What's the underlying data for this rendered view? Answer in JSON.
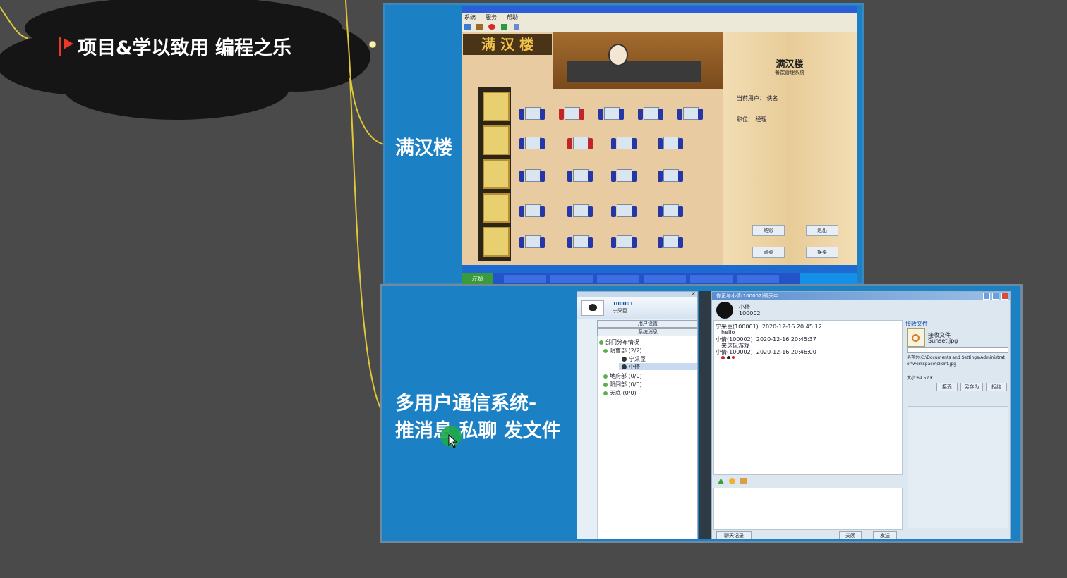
{
  "mindmap": {
    "root_label": "项目&学以致用 编程之乐",
    "topic1": "满汉楼",
    "topic2_line1": "多用户通信系统-",
    "topic2_line2": "推消息 私聊 发文件"
  },
  "restaurant_app": {
    "title_sign": "满 汉 楼",
    "menu": [
      "系统",
      "服务",
      "帮助"
    ],
    "panel_title": "满汉楼",
    "panel_subtitle": "餐饮管理系统",
    "current_user": "当前用户： 佚名",
    "role": "职位： 经理",
    "buttons": [
      "结账",
      "退出",
      "点菜",
      "换桌"
    ],
    "taskbar_start": "开始"
  },
  "chat_app": {
    "user_id": "100001",
    "user_name": "宁采臣",
    "btn_user_settings": "用户设置",
    "btn_system_messages": "系统消息",
    "tree": [
      {
        "label": "部门分布情况",
        "level": 0
      },
      {
        "label": "阴曹部 (2/2)",
        "level": 1
      },
      {
        "label": "宁采臣",
        "level": 2
      },
      {
        "label": "小倩",
        "level": 2,
        "selected": true
      },
      {
        "label": "地府部 (0/0)",
        "level": 1
      },
      {
        "label": "阳间部 (0/0)",
        "level": 1
      },
      {
        "label": "天庭 (0/0)",
        "level": 1
      }
    ],
    "chat_window_title": "你正与小倩(100002)聊天中...",
    "peer_name": "小倩",
    "peer_id": "100002",
    "messages": [
      {
        "sender": "宁采臣(100001)",
        "time": "2020-12-16 20:45:12",
        "text": "hello"
      },
      {
        "sender": "小倩(100002)",
        "time": "2020-12-16 20:45:37",
        "text": "来这玩游戏"
      },
      {
        "sender": "小倩(100002)",
        "time": "2020-12-16 20:46:00",
        "text": ""
      }
    ],
    "file_panel_title": "接收文件",
    "file_label": "接收文件",
    "file_name": "Sunset.jpg",
    "save_path": "另存为:C:\\Documents and Settings\\Administrator\\workspace\\client.jpg",
    "file_size": "大小:69.52 K",
    "file_buttons": [
      "接受",
      "另存为",
      "拒绝"
    ],
    "btn_history": "聊天记录",
    "btn_close": "关闭",
    "btn_send": "发送"
  }
}
